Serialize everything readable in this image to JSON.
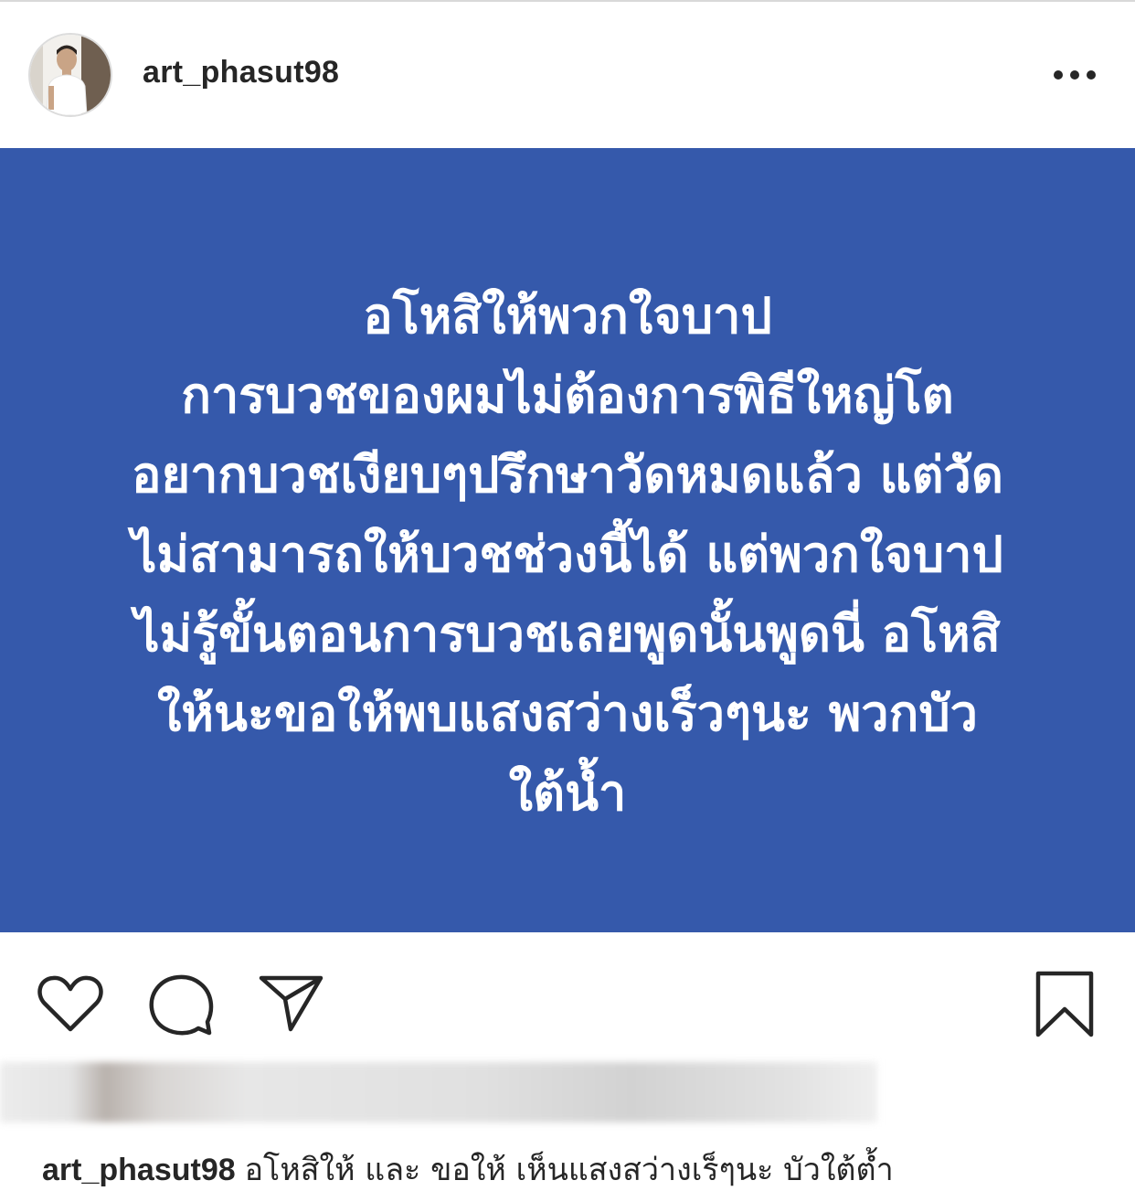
{
  "colors": {
    "post_background": "#3559ab",
    "text_primary": "#262626",
    "post_text": "#ffffff"
  },
  "header": {
    "username": "art_phasut98",
    "avatar_icon": "user-avatar",
    "more_icon": "more-horizontal-icon"
  },
  "post": {
    "lines": [
      "อโหสิให้พวกใจบาป",
      "การบวชของผมไม่ต้องการพิธีใหญ่โต",
      "อยากบวชเงียบๆปรึกษาวัดหมดแล้ว แต่วัด",
      "ไม่สามารถให้บวชช่วงนี้ได้ แต่พวกใจบาป",
      "ไม่รู้ขั้นตอนการบวชเลยพูดนั้นพูดนี่ อโหสิ",
      "ให้นะขอให้พบแสงสว่างเร็วๆนะ พวกบัว",
      "ใต้น้ำ"
    ]
  },
  "actions": {
    "like_icon": "heart-icon",
    "comment_icon": "comment-icon",
    "share_icon": "send-icon",
    "save_icon": "bookmark-icon"
  },
  "caption": {
    "username": "art_phasut98",
    "text": "อโหสิให้ และ ขอให้ เห็นแสงสว่างเร็ๆนะ บัวใต้ต้ำ"
  }
}
